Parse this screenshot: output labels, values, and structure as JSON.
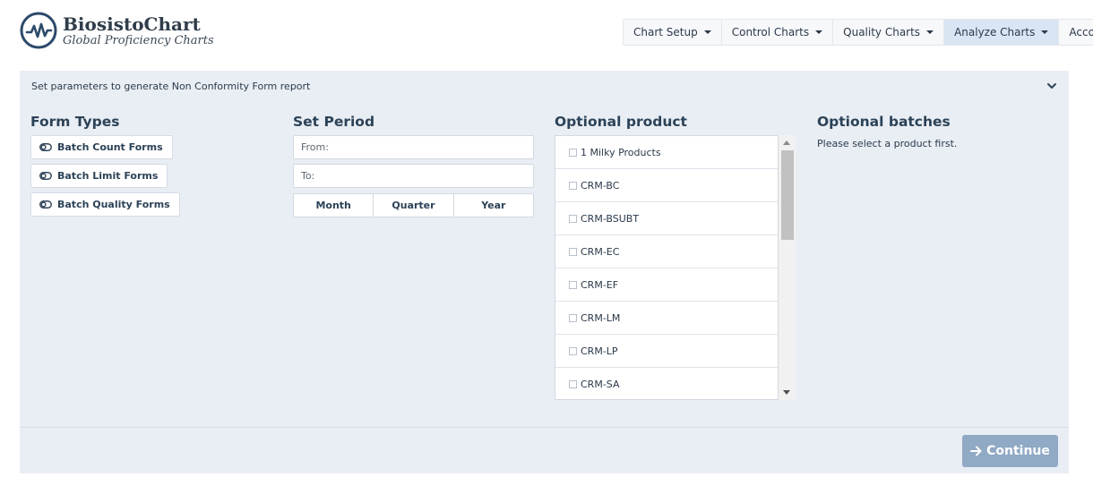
{
  "brand": {
    "name": "BiosistoChart",
    "tagline": "Global Proficiency Charts",
    "logo_icon": "pulse-circle-icon"
  },
  "nav": {
    "items": [
      {
        "label": "Chart Setup",
        "active": false
      },
      {
        "label": "Control Charts",
        "active": false
      },
      {
        "label": "Quality Charts",
        "active": false
      },
      {
        "label": "Analyze Charts",
        "active": true
      },
      {
        "label": "Account",
        "active": false
      }
    ]
  },
  "panel": {
    "header_text": "Set parameters to generate Non Conformity Form report",
    "collapse_icon": "chevron-down-icon"
  },
  "form_types": {
    "title": "Form Types",
    "items": [
      {
        "label": "Batch Count Forms",
        "icon": "toggle-icon"
      },
      {
        "label": "Batch Limit Forms",
        "icon": "toggle-icon"
      },
      {
        "label": "Batch Quality Forms",
        "icon": "toggle-icon"
      }
    ]
  },
  "period": {
    "title": "Set Period",
    "from_placeholder": "From:",
    "to_placeholder": "To:",
    "from_value": "",
    "to_value": "",
    "buttons": [
      "Month",
      "Quarter",
      "Year"
    ]
  },
  "products": {
    "title": "Optional product",
    "items": [
      {
        "label": "1 Milky Products",
        "checked": false
      },
      {
        "label": "CRM-BC",
        "checked": false
      },
      {
        "label": "CRM-BSUBT",
        "checked": false
      },
      {
        "label": "CRM-EC",
        "checked": false
      },
      {
        "label": "CRM-EF",
        "checked": false
      },
      {
        "label": "CRM-LM",
        "checked": false
      },
      {
        "label": "CRM-LP",
        "checked": false
      },
      {
        "label": "CRM-SA",
        "checked": false
      }
    ]
  },
  "batches": {
    "title": "Optional batches",
    "note": "Please select a product first."
  },
  "footer": {
    "continue_label": "Continue",
    "continue_icon": "arrow-right-icon"
  },
  "colors": {
    "panel_bg": "#e9eef4",
    "nav_active": "#d9e5f3",
    "heading": "#2c4257",
    "continue_bg": "#90a9c4"
  }
}
